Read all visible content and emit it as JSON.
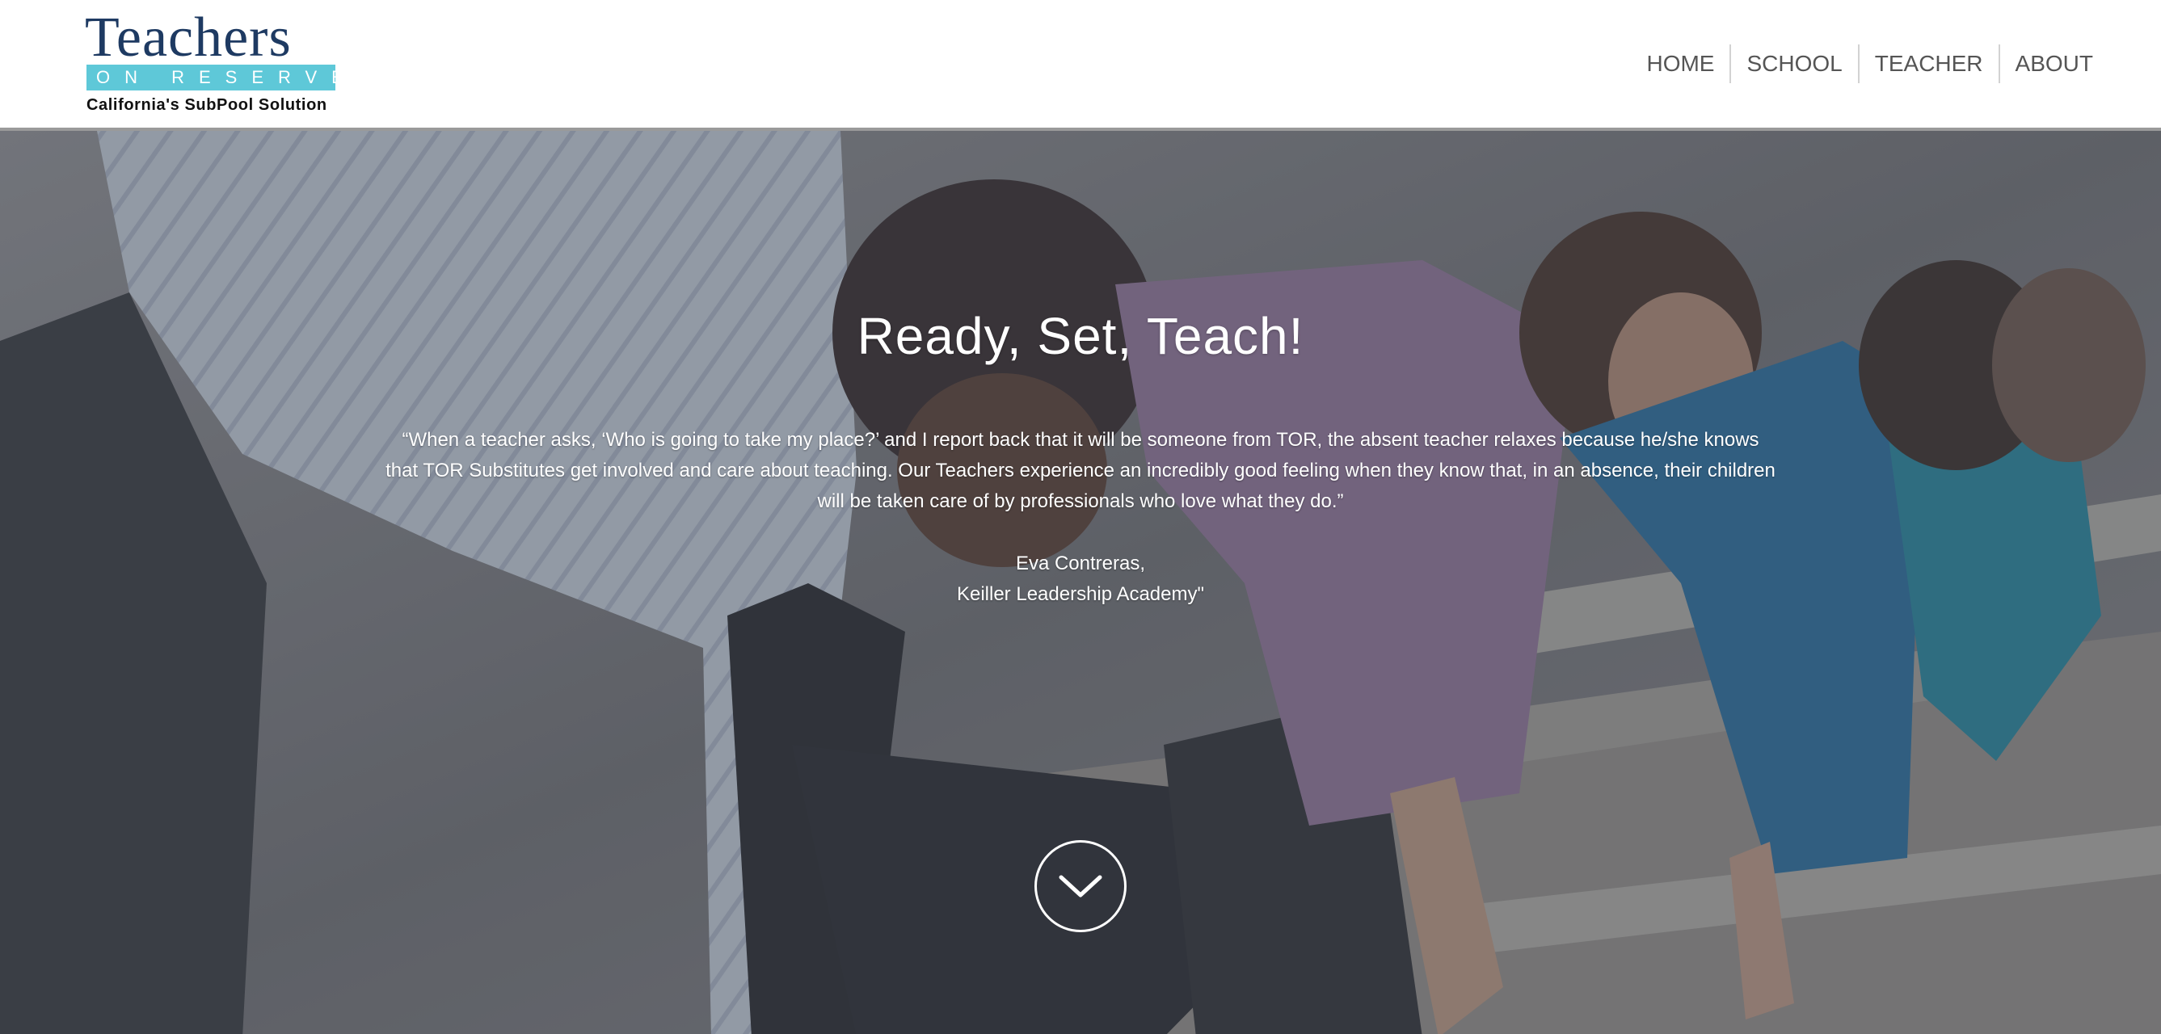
{
  "logo": {
    "wordmark": "Teachers",
    "subwordmark": "ON RESERVE",
    "tagline": "California's SubPool Solution"
  },
  "nav": {
    "items": [
      {
        "label": "HOME"
      },
      {
        "label": "SCHOOL"
      },
      {
        "label": "TEACHER"
      },
      {
        "label": "ABOUT"
      }
    ]
  },
  "hero": {
    "title": "Ready, Set, Teach!",
    "quote": "“When a teacher asks, ‘Who is going to take my place?’ and I report back that it will be someone from TOR, the absent teacher relaxes because he/she knows that TOR Substitutes get involved and care about teaching. Our Teachers experience an incredibly good feeling when they know that, in an absence, their children will be taken care of by professionals who love what they do.”",
    "author_name": "Eva Contreras,",
    "author_org": "Keiller Leadership Academy\"",
    "scroll_icon": "chevron-down-icon"
  },
  "colors": {
    "brand_navy": "#1e3a62",
    "brand_teal": "#5ec8d8",
    "nav_text": "#555555",
    "hero_text": "#ffffff"
  }
}
